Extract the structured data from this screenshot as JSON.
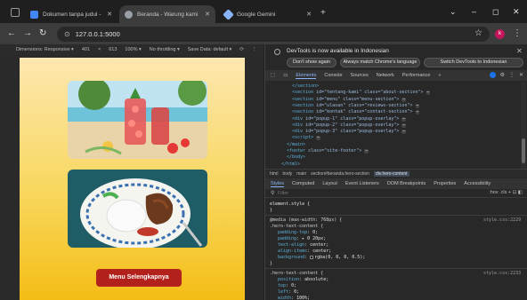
{
  "browser": {
    "tabs": [
      {
        "title": "Dokumen tanpa judul - Google",
        "favicon_color": "#4285f4"
      },
      {
        "title": "Beranda - Warung kami",
        "favicon_color": "#9aa0a6"
      },
      {
        "title": "Google Gemini",
        "favicon_color": "#8ab4f8"
      }
    ],
    "new_tab": "+",
    "window_controls": [
      "⌄",
      "–",
      "◻",
      "✕"
    ],
    "url": "127.0.0.1:5000",
    "profile_initial": "k"
  },
  "device_toolbar": {
    "dimensions": "Dimensions: Responsive ▾",
    "width": "401",
    "x": "×",
    "height": "613",
    "zoom": "100% ▾",
    "throttle": "No throttling ▾",
    "save_data": "Save Data: default ▾"
  },
  "page": {
    "cta_label": "Menu Selengkapnya",
    "colors": {
      "gradient_top": "#fde7b0",
      "gradient_bottom": "#f4bd15",
      "button": "#b3211c"
    }
  },
  "devtools": {
    "info_message": "DevTools is now available in Indonesian",
    "btn_dont_show": "Don't show again",
    "btn_always_match": "Always match Chrome's language",
    "btn_switch": "Switch DevTools to Indonesian",
    "tabs": [
      "Elements",
      "Console",
      "Sources",
      "Network",
      "Performance",
      "»"
    ],
    "dom_lines": [
      {
        "indent": 2,
        "open": "</section>",
        "attrs": ""
      },
      {
        "indent": 2,
        "open": "<section",
        "attrs": " id=\"tentang-kami\" class=\"about-section\">",
        "ell": "⋯"
      },
      {
        "indent": 2,
        "open": "<section",
        "attrs": " id=\"menu\" class=\"menu-section\">",
        "ell": "⋯"
      },
      {
        "indent": 2,
        "open": "<section",
        "attrs": " id=\"ulasan\" class=\"reviews-section\">",
        "ell": "⋯"
      },
      {
        "indent": 2,
        "open": "<section",
        "attrs": " id=\"kontak\" class=\"contact-section\">",
        "ell": "⋯"
      },
      {
        "indent": 2,
        "open": "<div",
        "attrs": " id=\"popup-1\" class=\"popup-overlay\">",
        "ell": "⋯"
      },
      {
        "indent": 2,
        "open": "<div",
        "attrs": " id=\"popup-2\" class=\"popup-overlay\">",
        "ell": "⋯"
      },
      {
        "indent": 2,
        "open": "<div",
        "attrs": " id=\"popup-3\" class=\"popup-overlay\">",
        "ell": "⋯"
      },
      {
        "indent": 2,
        "open": "<script>",
        "attrs": "",
        "ell": "⋯"
      },
      {
        "indent": 1,
        "open": "</main>",
        "attrs": ""
      },
      {
        "indent": 1,
        "open": "<footer",
        "attrs": " class=\"site-footer\">",
        "ell": "⋯"
      },
      {
        "indent": 1,
        "open": "</body>",
        "attrs": ""
      },
      {
        "indent": 0,
        "open": "</html>",
        "attrs": ""
      }
    ],
    "breadcrumb": [
      "html",
      "body",
      "main",
      "section#beranda.hero-section",
      "div.hero-content"
    ],
    "style_tabs": [
      "Styles",
      "Computed",
      "Layout",
      "Event Listeners",
      "DOM Breakpoints",
      "Properties",
      "Accessibility"
    ],
    "filter_placeholder": "Filter",
    "filter_options": ":hov .cls + ⊡ ◧",
    "styles": {
      "element_style": "element.style {",
      "close": "}",
      "media_query": "@media (max-width: 768px) {",
      "media_selector": ".hero-text-content {",
      "media_source": "style.css:2229",
      "media_props": [
        {
          "name": "padding-top",
          "value": "0;"
        },
        {
          "name": "padding",
          "value": "▸ 0 20px;"
        },
        {
          "name": "text-align",
          "value": "center;"
        },
        {
          "name": "align-items",
          "value": "center;"
        },
        {
          "name": "background",
          "value": "rgba(0, 0, 0, 0.5);",
          "swatch": true
        }
      ],
      "rule2_selector": ".hero-text-content {",
      "rule2_source": "style.css:2233",
      "rule2_props": [
        {
          "name": "position",
          "value": "absolute;"
        },
        {
          "name": "top",
          "value": "0;"
        },
        {
          "name": "left",
          "value": "0;"
        },
        {
          "name": "width",
          "value": "100%;"
        }
      ]
    }
  }
}
